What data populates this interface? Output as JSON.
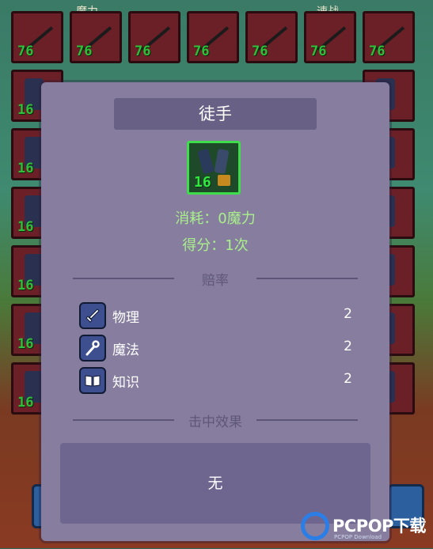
{
  "background": {
    "top_labels": [
      "魔力",
      "速战"
    ],
    "cells": [
      {
        "row": 0,
        "col": 0,
        "num": "76",
        "kind": "sword"
      },
      {
        "row": 0,
        "col": 1,
        "num": "76",
        "kind": "sword"
      },
      {
        "row": 0,
        "col": 2,
        "num": "76",
        "kind": "sword"
      },
      {
        "row": 0,
        "col": 3,
        "num": "76",
        "kind": "sword"
      },
      {
        "row": 0,
        "col": 4,
        "num": "76",
        "kind": "sword"
      },
      {
        "row": 0,
        "col": 5,
        "num": "76",
        "kind": "sword"
      },
      {
        "row": 0,
        "col": 6,
        "num": "76",
        "kind": "sword"
      },
      {
        "row": 1,
        "col": 0,
        "num": "16",
        "kind": "gauntlet"
      },
      {
        "row": 1,
        "col": 6,
        "num": "",
        "kind": "gauntlet"
      },
      {
        "row": 2,
        "col": 0,
        "num": "16",
        "kind": "gauntlet"
      },
      {
        "row": 2,
        "col": 6,
        "num": "",
        "kind": "gauntlet"
      },
      {
        "row": 3,
        "col": 0,
        "num": "16",
        "kind": "gauntlet"
      },
      {
        "row": 3,
        "col": 6,
        "num": "",
        "kind": "gauntlet"
      },
      {
        "row": 4,
        "col": 0,
        "num": "16",
        "kind": "gauntlet"
      },
      {
        "row": 4,
        "col": 6,
        "num": "",
        "kind": "gauntlet"
      },
      {
        "row": 5,
        "col": 0,
        "num": "16",
        "kind": "gauntlet"
      },
      {
        "row": 5,
        "col": 6,
        "num": "",
        "kind": "gauntlet"
      },
      {
        "row": 6,
        "col": 0,
        "num": "16",
        "kind": "gauntlet"
      },
      {
        "row": 6,
        "col": 6,
        "num": "",
        "kind": "gauntlet"
      }
    ]
  },
  "dialog": {
    "title": "徒手",
    "item": {
      "count": "16",
      "icon": "gauntlet-icon"
    },
    "cost": "消耗：0魔力",
    "score": "得分：1次",
    "odds_label": "赔率",
    "stats": [
      {
        "label": "物理",
        "value": "2",
        "icon": "sword-icon"
      },
      {
        "label": "魔法",
        "value": "2",
        "icon": "staff-icon"
      },
      {
        "label": "知识",
        "value": "2",
        "icon": "book-icon"
      }
    ],
    "effect_label": "击中效果",
    "effect_text": "无"
  },
  "watermark": {
    "brand": "PCPOP下载",
    "sub": "PCPOP Download"
  },
  "colors": {
    "dialog_bg": "#877d9f",
    "title_bar": "#696185",
    "accent_green": "#a9f08b",
    "item_border": "#3fdc4b",
    "icon_bg": "#3d4f8e"
  }
}
